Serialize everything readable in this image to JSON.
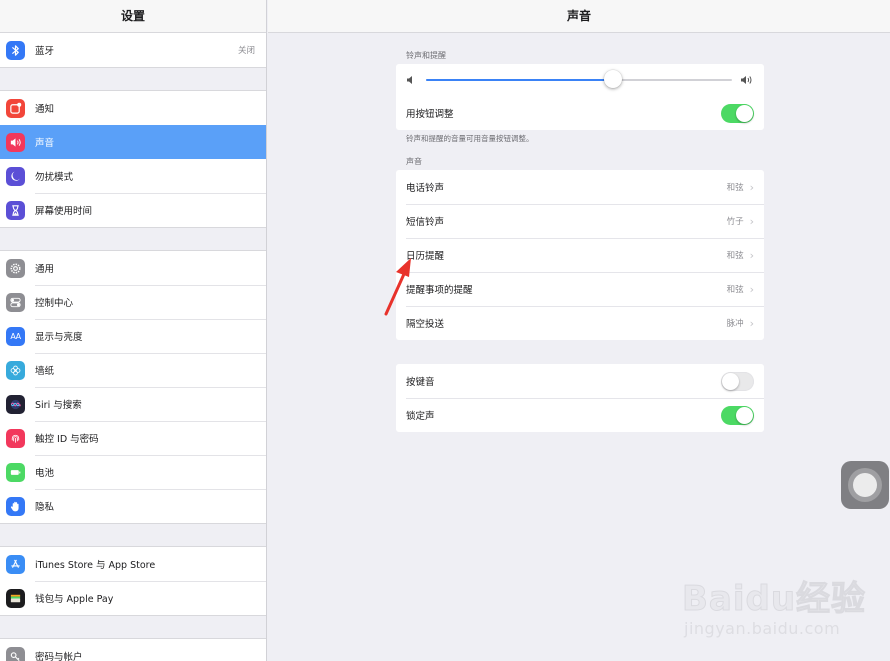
{
  "sidebar": {
    "title": "设置",
    "top_item": {
      "label": "蓝牙",
      "value": "关闭",
      "icon": "bluetooth-icon",
      "color": "#3478f6"
    },
    "groups": [
      [
        {
          "label": "通知",
          "icon": "notifications-icon",
          "color": "#f2463a"
        },
        {
          "label": "声音",
          "icon": "speaker-icon",
          "color": "#f2385c",
          "selected": true
        },
        {
          "label": "勿扰模式",
          "icon": "moon-icon",
          "color": "#5b4fd6"
        },
        {
          "label": "屏幕使用时间",
          "icon": "hourglass-icon",
          "color": "#5b4fd6"
        }
      ],
      [
        {
          "label": "通用",
          "icon": "gear-icon",
          "color": "#8e8e93"
        },
        {
          "label": "控制中心",
          "icon": "control-center-icon",
          "color": "#8e8e93"
        },
        {
          "label": "显示与亮度",
          "icon": "display-icon",
          "color": "#3478f6"
        },
        {
          "label": "墙纸",
          "icon": "wallpaper-icon",
          "color": "#37aadc"
        },
        {
          "label": "Siri 与搜索",
          "icon": "siri-icon",
          "color": "#222233"
        },
        {
          "label": "触控 ID 与密码",
          "icon": "fingerprint-icon",
          "color": "#f2385c"
        },
        {
          "label": "电池",
          "icon": "battery-icon",
          "color": "#4cd964"
        },
        {
          "label": "隐私",
          "icon": "hand-icon",
          "color": "#3478f6"
        }
      ],
      [
        {
          "label": "iTunes Store 与 App Store",
          "icon": "app-store-icon",
          "color": "#3a8df5"
        },
        {
          "label": "钱包与 Apple Pay",
          "icon": "wallet-icon",
          "color": "#1c1c1e"
        }
      ],
      [
        {
          "label": "密码与帐户",
          "icon": "key-icon",
          "color": "#8e8e93"
        }
      ]
    ]
  },
  "main": {
    "title": "声音",
    "ringer": {
      "section_label": "铃声和提醒",
      "volume_level": 0.61,
      "adjust_label": "用按钮调整",
      "adjust_on": true,
      "footnote": "铃声和提醒的音量可用音量按钮调整。"
    },
    "sounds": {
      "section_label": "声音",
      "rows": [
        {
          "label": "电话铃声",
          "value": "和弦"
        },
        {
          "label": "短信铃声",
          "value": "竹子"
        },
        {
          "label": "日历提醒",
          "value": "和弦"
        },
        {
          "label": "提醒事项的提醒",
          "value": "和弦"
        },
        {
          "label": "隔空投送",
          "value": "脉冲"
        }
      ]
    },
    "toggles": [
      {
        "label": "按键音",
        "on": false
      },
      {
        "label": "锁定声",
        "on": true
      }
    ]
  },
  "watermark": {
    "brand": "Baidu经验",
    "url": "jingyan.baidu.com"
  },
  "colors": {
    "accent": "#5aa0f8",
    "toggle_on": "#4cd964",
    "slider": "#3a82f6",
    "arrow": "#e8322b"
  }
}
